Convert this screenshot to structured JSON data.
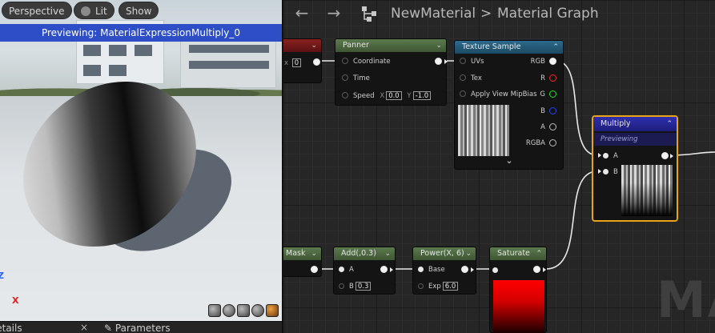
{
  "viewport": {
    "perspective_label": "Perspective",
    "lit_label": "Lit",
    "show_label": "Show",
    "preview_banner": "Previewing: MaterialExpressionMultiply_0",
    "axis_z": "Z",
    "axis_x": "X"
  },
  "bottom_tabs": {
    "details_label": "Details",
    "close_glyph": "×",
    "parameters_label": "Parameters"
  },
  "graph": {
    "back_glyph": "←",
    "forward_glyph": "→",
    "breadcrumb_root": "NewMaterial",
    "breadcrumb_sep": ">",
    "breadcrumb_current": "Material Graph",
    "watermark": "MA"
  },
  "nodes": {
    "panner": {
      "title": "Panner",
      "coordinate": "Coordinate",
      "time": "Time",
      "speed": "Speed",
      "speed_x_label": "X",
      "speed_x": "0.0",
      "speed_y_label": "Y",
      "speed_y": "-1.0"
    },
    "texture_sample": {
      "title": "Texture Sample",
      "uvs": "UVs",
      "tex": "Tex",
      "mip": "Apply View MipBias",
      "out_rgb": "RGB",
      "out_r": "R",
      "out_g": "G",
      "out_b": "B",
      "out_a": "A",
      "out_rgba": "RGBA",
      "expand_glyph": "⌄"
    },
    "multiply": {
      "title": "Multiply",
      "subtitle": "Previewing",
      "in_a": "A",
      "in_b": "B"
    },
    "red_node": {
      "index_label": "x",
      "index_value": "0"
    },
    "mask": {
      "title": "Mask"
    },
    "add": {
      "title": "Add(,0.3)",
      "in_a": "A",
      "in_b": "B",
      "b_value": "0.3"
    },
    "power": {
      "title": "Power(X, 6)",
      "in_base": "Base",
      "in_exp": "Exp",
      "exp_value": "6.0"
    },
    "saturate": {
      "title": "Saturate"
    }
  },
  "colors": {
    "preview_banner": "#2d4ec7",
    "multiply_header": "#2f2fb0",
    "selection_outline": "#e8a317",
    "pin_r": "#ff2020",
    "pin_g": "#20e020",
    "pin_b": "#2040ff",
    "axis_x": "#e02020",
    "axis_z": "#2a60ff"
  },
  "chevron_glyph": "⌃"
}
